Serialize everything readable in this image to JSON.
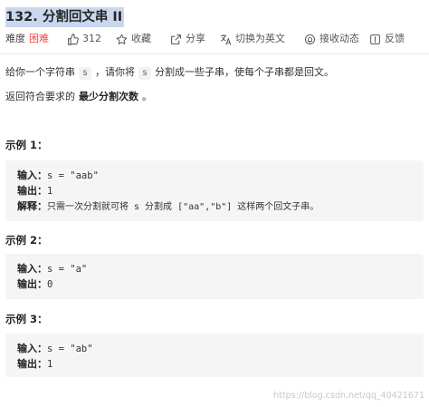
{
  "problem": {
    "title": "132. 分割回文串 II"
  },
  "toolbar": {
    "difficulty_label": "难度",
    "difficulty_value": "困难",
    "likes_count": "312",
    "favorite_label": "收藏",
    "share_label": "分享",
    "switch_lang_label": "切换为英文",
    "notify_label": "接收动态",
    "feedback_label": "反馈"
  },
  "description": {
    "line1_before": "给你一个字符串",
    "line1_code": "s",
    "line1_middle": "，请你将",
    "line1_code2": "s",
    "line1_after": "分割成一些子串，使每个子串都是回文。",
    "line2_before": "返回符合要求的",
    "line2_bold": "最少分割次数",
    "line2_after": "。"
  },
  "examples": [
    {
      "title": "示例 1：",
      "input_label": "输入：",
      "input_value": "s = \"aab\"",
      "output_label": "输出：",
      "output_value": "1",
      "explain_label": "解释：",
      "explain_value": "只需一次分割就可将 s 分割成 [\"aa\",\"b\"] 这样两个回文子串。"
    },
    {
      "title": "示例 2：",
      "input_label": "输入：",
      "input_value": "s = \"a\"",
      "output_label": "输出：",
      "output_value": "0"
    },
    {
      "title": "示例 3：",
      "input_label": "输入：",
      "input_value": "s = \"ab\"",
      "output_label": "输出：",
      "output_value": "1"
    }
  ],
  "watermark": "https://blog.csdn.net/qq_40421671",
  "colors": {
    "difficulty_hard": "#ef4743",
    "title_highlight": "#c9d7ef",
    "example_bg": "#f5f5f5"
  }
}
